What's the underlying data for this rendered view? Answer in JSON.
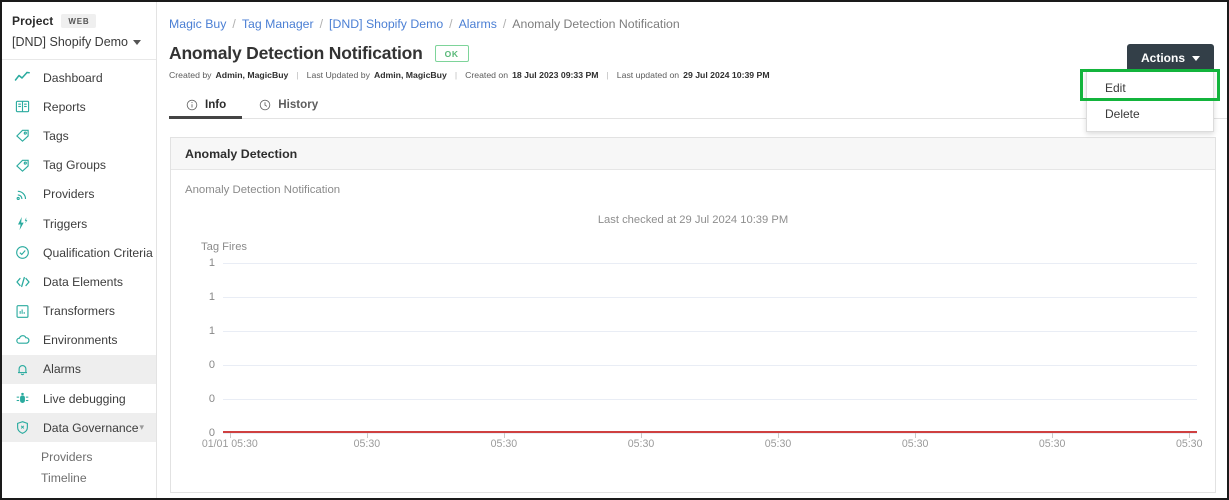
{
  "sidebar": {
    "project_label": "Project",
    "project_badge": "WEB",
    "project_name": "[DND] Shopify Demo",
    "items": [
      {
        "label": "Dashboard",
        "icon": "line-chart-icon",
        "active": false
      },
      {
        "label": "Reports",
        "icon": "book-icon",
        "active": false
      },
      {
        "label": "Tags",
        "icon": "tag-icon",
        "active": false
      },
      {
        "label": "Tag Groups",
        "icon": "tags-icon",
        "active": false
      },
      {
        "label": "Providers",
        "icon": "rss-icon",
        "active": false
      },
      {
        "label": "Triggers",
        "icon": "bolt-icon",
        "active": false
      },
      {
        "label": "Qualification Criteria",
        "icon": "check-circle-icon",
        "active": false
      },
      {
        "label": "Data Elements",
        "icon": "code-icon",
        "active": false
      },
      {
        "label": "Transformers",
        "icon": "transform-icon",
        "active": false
      },
      {
        "label": "Environments",
        "icon": "cloud-icon",
        "active": false
      },
      {
        "label": "Alarms",
        "icon": "bell-icon",
        "active": true
      },
      {
        "label": "Live debugging",
        "icon": "bug-icon",
        "active": false
      },
      {
        "label": "Data Governance",
        "icon": "shield-icon",
        "active": false,
        "expandable": true
      }
    ],
    "sub_items": [
      {
        "label": "Providers"
      },
      {
        "label": "Timeline"
      }
    ]
  },
  "breadcrumb": {
    "items": [
      {
        "label": "Magic Buy",
        "link": true
      },
      {
        "label": "Tag Manager",
        "link": true
      },
      {
        "label": "[DND] Shopify Demo",
        "link": true
      },
      {
        "label": "Alarms",
        "link": true
      },
      {
        "label": "Anomaly Detection Notification",
        "link": false
      }
    ],
    "separator": "/"
  },
  "header": {
    "title": "Anomaly Detection Notification",
    "status_badge": "OK",
    "meta": {
      "created_by_label": "Created by",
      "created_by_value": "Admin, MagicBuy",
      "last_updated_by_label": "Last Updated by",
      "last_updated_by_value": "Admin, MagicBuy",
      "created_on_label": "Created on",
      "created_on_value": "18 Jul 2023 09:33 PM",
      "last_updated_label": "Last updated on",
      "last_updated_value": "29 Jul 2024 10:39 PM"
    }
  },
  "actions": {
    "button_label": "Actions",
    "menu": [
      {
        "label": "Edit",
        "highlighted": true
      },
      {
        "label": "Delete",
        "highlighted": false
      }
    ]
  },
  "tabs": [
    {
      "label": "Info",
      "icon": "info-circle-icon",
      "active": true
    },
    {
      "label": "History",
      "icon": "clock-icon",
      "active": false
    }
  ],
  "card": {
    "title": "Anomaly Detection",
    "subtitle": "Anomaly Detection Notification"
  },
  "colors": {
    "accent_teal": "#2aab9f",
    "link_blue": "#4b7fd4",
    "status_green": "#58b878",
    "highlight_green": "#13b43c",
    "chart_line_red": "#cf4040",
    "actions_dark": "#333f48"
  },
  "chart_data": {
    "type": "line",
    "title": "",
    "annotation": "Last checked at 29 Jul 2024 10:39 PM",
    "ylabel": "Tag Fires",
    "xlabel": "",
    "grid": true,
    "legend": "none",
    "ytick_labels": [
      "1",
      "1",
      "1",
      "0",
      "0",
      "0"
    ],
    "ylim": [
      0,
      1
    ],
    "xtick_labels": [
      "01/01 05:30",
      "05:30",
      "05:30",
      "05:30",
      "05:30",
      "05:30",
      "05:30",
      "05:30"
    ],
    "series": [
      {
        "name": "Tag Fires",
        "color": "#cf4040",
        "x": [
          "01/01 05:30",
          "05:30",
          "05:30",
          "05:30",
          "05:30",
          "05:30",
          "05:30",
          "05:30"
        ],
        "values": [
          0,
          0,
          0,
          0,
          0,
          0,
          0,
          0
        ]
      }
    ]
  }
}
